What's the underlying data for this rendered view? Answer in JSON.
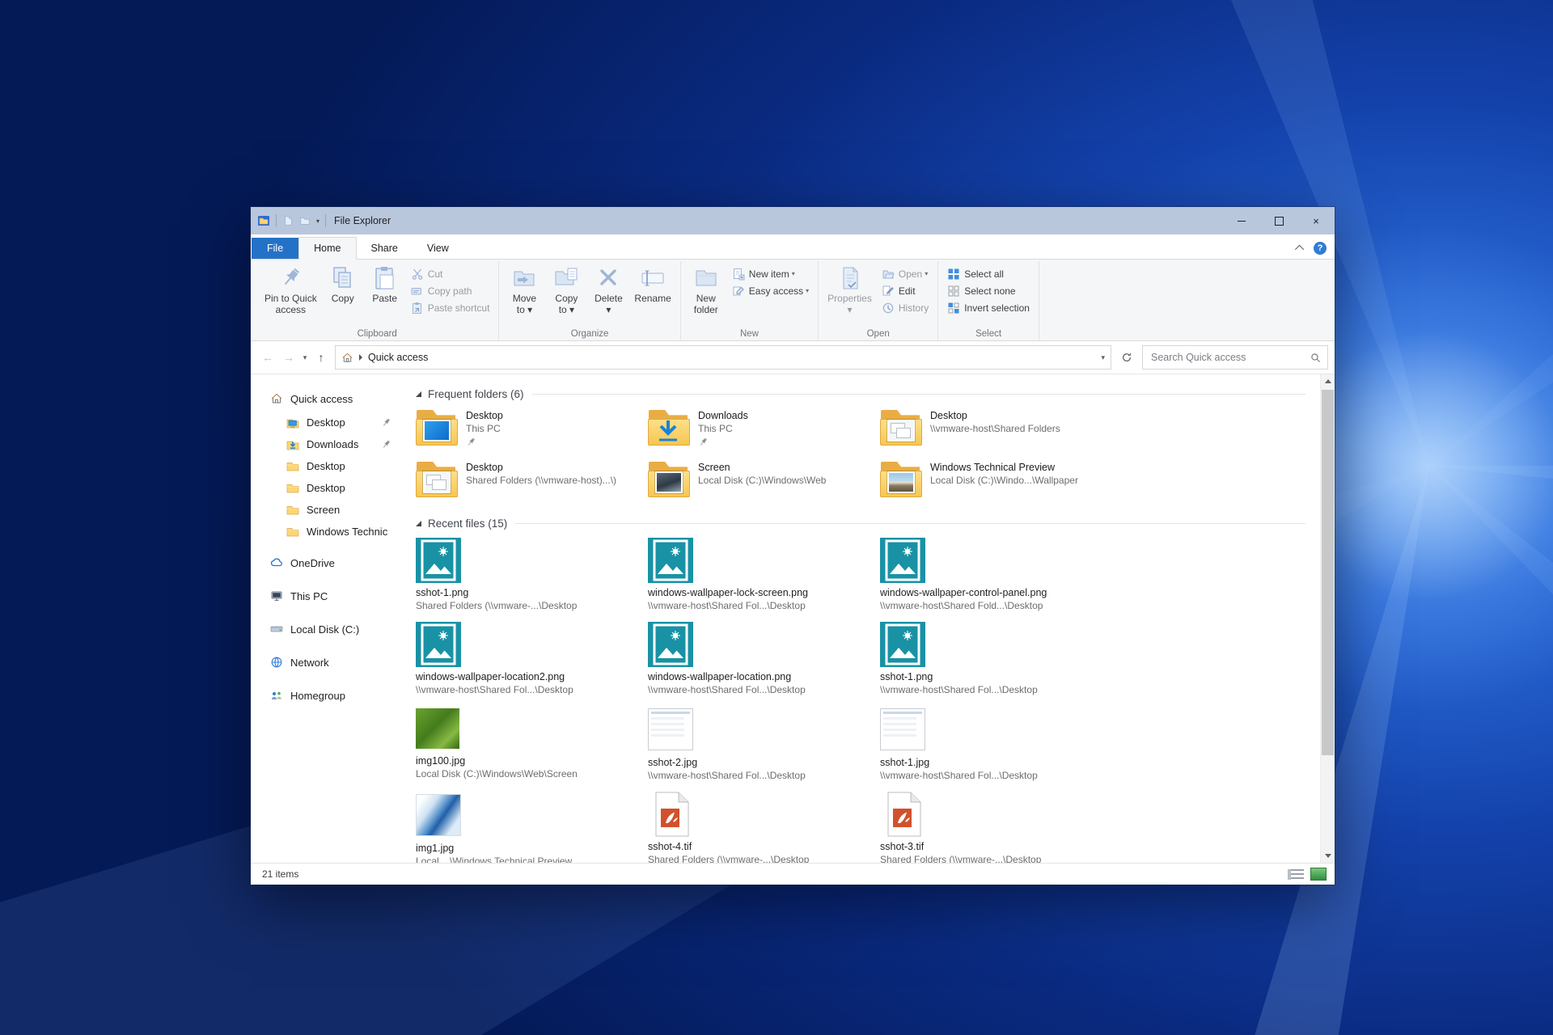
{
  "window": {
    "title": "File Explorer",
    "qat": {
      "logo_icon": "explorer-logo",
      "button_icons": [
        "qat-page",
        "qat-folder"
      ],
      "menu_icon": "qat-caret"
    },
    "controls": {
      "minimize": "minimize",
      "maximize": "maximize",
      "close": "close"
    }
  },
  "tabs": {
    "file": "File",
    "items": [
      {
        "label": "Home",
        "active": true
      },
      {
        "label": "Share",
        "active": false
      },
      {
        "label": "View",
        "active": false
      }
    ],
    "help": "?"
  },
  "ribbon": {
    "groups": [
      {
        "label": "Clipboard",
        "large": [
          {
            "label": "Pin to Quick access",
            "lines": [
              "Pin to Quick",
              "access"
            ],
            "icon": "pin",
            "disabled": false
          },
          {
            "label": "Copy",
            "lines": [
              "Copy"
            ],
            "icon": "copy",
            "disabled": false
          },
          {
            "label": "Paste",
            "lines": [
              "Paste"
            ],
            "icon": "paste",
            "disabled": false
          }
        ],
        "small": [
          {
            "label": "Cut",
            "icon": "cut",
            "disabled": true,
            "dropdown": false
          },
          {
            "label": "Copy path",
            "icon": "copy-path",
            "disabled": true,
            "dropdown": false
          },
          {
            "label": "Paste shortcut",
            "icon": "paste-shortcut",
            "disabled": true,
            "dropdown": false
          }
        ]
      },
      {
        "label": "Organize",
        "large": [
          {
            "label": "Move to",
            "lines": [
              "Move",
              "to ▾"
            ],
            "icon": "move-to",
            "disabled": false
          },
          {
            "label": "Copy to",
            "lines": [
              "Copy",
              "to ▾"
            ],
            "icon": "copy-to",
            "disabled": false
          },
          {
            "label": "Delete",
            "lines": [
              "Delete",
              "▾"
            ],
            "icon": "delete",
            "disabled": false
          },
          {
            "label": "Rename",
            "lines": [
              "Rename"
            ],
            "icon": "rename",
            "disabled": false
          }
        ],
        "small": []
      },
      {
        "label": "New",
        "large": [
          {
            "label": "New folder",
            "lines": [
              "New",
              "folder"
            ],
            "icon": "new-folder",
            "disabled": false
          }
        ],
        "small": [
          {
            "label": "New item",
            "icon": "new-item",
            "disabled": false,
            "dropdown": true
          },
          {
            "label": "Easy access",
            "icon": "easy-access",
            "disabled": false,
            "dropdown": true
          }
        ]
      },
      {
        "label": "Open",
        "large": [
          {
            "label": "Properties",
            "lines": [
              "Properties",
              "▾"
            ],
            "icon": "properties",
            "disabled": true
          }
        ],
        "small": [
          {
            "label": "Open",
            "icon": "open",
            "disabled": true,
            "dropdown": true
          },
          {
            "label": "Edit",
            "icon": "edit",
            "disabled": false,
            "dropdown": false
          },
          {
            "label": "History",
            "icon": "history",
            "disabled": true,
            "dropdown": false
          }
        ]
      },
      {
        "label": "Select",
        "large": [],
        "small": [
          {
            "label": "Select all",
            "icon": "select-all",
            "disabled": false,
            "dropdown": false
          },
          {
            "label": "Select none",
            "icon": "select-none",
            "disabled": false,
            "dropdown": false
          },
          {
            "label": "Invert selection",
            "icon": "invert-selection",
            "disabled": false,
            "dropdown": false
          }
        ]
      }
    ]
  },
  "addressbar": {
    "breadcrumb_root": "Quick access",
    "search_placeholder": "Search Quick access"
  },
  "sidebar": {
    "items": [
      {
        "label": "Quick access",
        "icon": "home",
        "level": 0,
        "pinned": false
      },
      {
        "label": "Desktop",
        "icon": "sb-desktop",
        "level": 1,
        "pinned": true
      },
      {
        "label": "Downloads",
        "icon": "sb-downloads",
        "level": 1,
        "pinned": true
      },
      {
        "label": "Desktop",
        "icon": "folder",
        "level": 1,
        "pinned": false
      },
      {
        "label": "Desktop",
        "icon": "folder",
        "level": 1,
        "pinned": false
      },
      {
        "label": "Screen",
        "icon": "folder",
        "level": 1,
        "pinned": false
      },
      {
        "label": "Windows Technic",
        "icon": "folder",
        "level": 1,
        "pinned": false
      },
      {
        "label": "OneDrive",
        "icon": "cloud",
        "level": 0,
        "pinned": false
      },
      {
        "label": "This PC",
        "icon": "pc",
        "level": 0,
        "pinned": false
      },
      {
        "label": "Local Disk (C:)",
        "icon": "disk",
        "level": 0,
        "pinned": false
      },
      {
        "label": "Network",
        "icon": "network",
        "level": 0,
        "pinned": false
      },
      {
        "label": "Homegroup",
        "icon": "homegroup",
        "level": 0,
        "pinned": false
      }
    ]
  },
  "content": {
    "sections": [
      {
        "title": "Frequent folders (6)",
        "items": [
          {
            "name": "Desktop",
            "path": "This PC",
            "pinned": true,
            "thumb": "desktop"
          },
          {
            "name": "Downloads",
            "path": "This PC",
            "pinned": true,
            "thumb": "downloads"
          },
          {
            "name": "Desktop",
            "path": "\\\\vmware-host\\Shared Folders",
            "pinned": false,
            "thumb": "windows"
          },
          {
            "name": "Desktop",
            "path": "Shared Folders (\\\\vmware-host)...\\)",
            "pinned": false,
            "thumb": "windows"
          },
          {
            "name": "Screen",
            "path": "Local Disk (C:)\\Windows\\Web",
            "pinned": false,
            "thumb": "photo-dark"
          },
          {
            "name": "Windows Technical Preview",
            "path": "Local Disk (C:)\\Windo...\\Wallpaper",
            "pinned": false,
            "thumb": "photo-beach"
          }
        ]
      },
      {
        "title": "Recent files (15)",
        "items": [
          {
            "name": "sshot-1.png",
            "path": "Shared Folders (\\\\vmware-...\\Desktop",
            "thumb": "image"
          },
          {
            "name": "windows-wallpaper-lock-screen.png",
            "path": "\\\\vmware-host\\Shared Fol...\\Desktop",
            "thumb": "image"
          },
          {
            "name": "windows-wallpaper-control-panel.png",
            "path": "\\\\vmware-host\\Shared Fold...\\Desktop",
            "thumb": "image"
          },
          {
            "name": "windows-wallpaper-location2.png",
            "path": "\\\\vmware-host\\Shared Fol...\\Desktop",
            "thumb": "image"
          },
          {
            "name": "windows-wallpaper-location.png",
            "path": "\\\\vmware-host\\Shared Fol...\\Desktop",
            "thumb": "image"
          },
          {
            "name": "sshot-1.png",
            "path": "\\\\vmware-host\\Shared Fol...\\Desktop",
            "thumb": "image"
          },
          {
            "name": "img100.jpg",
            "path": "Local Disk (C:)\\Windows\\Web\\Screen",
            "thumb": "green"
          },
          {
            "name": "sshot-2.jpg",
            "path": "\\\\vmware-host\\Shared Fol...\\Desktop",
            "thumb": "shot"
          },
          {
            "name": "sshot-1.jpg",
            "path": "\\\\vmware-host\\Shared Fol...\\Desktop",
            "thumb": "shot"
          },
          {
            "name": "img1.jpg",
            "path": "Local ...\\Windows Technical Preview",
            "thumb": "wave"
          },
          {
            "name": "sshot-4.tif",
            "path": "Shared Folders (\\\\vmware-...\\Desktop",
            "thumb": "tif"
          },
          {
            "name": "sshot-3.tif",
            "path": "Shared Folders (\\\\vmware-...\\Desktop",
            "thumb": "tif"
          }
        ],
        "partial": [
          {
            "thumb": "page"
          },
          {
            "thumb": "page"
          },
          {
            "thumb": "bluetop"
          }
        ]
      }
    ]
  },
  "statusbar": {
    "count": "21 items"
  }
}
